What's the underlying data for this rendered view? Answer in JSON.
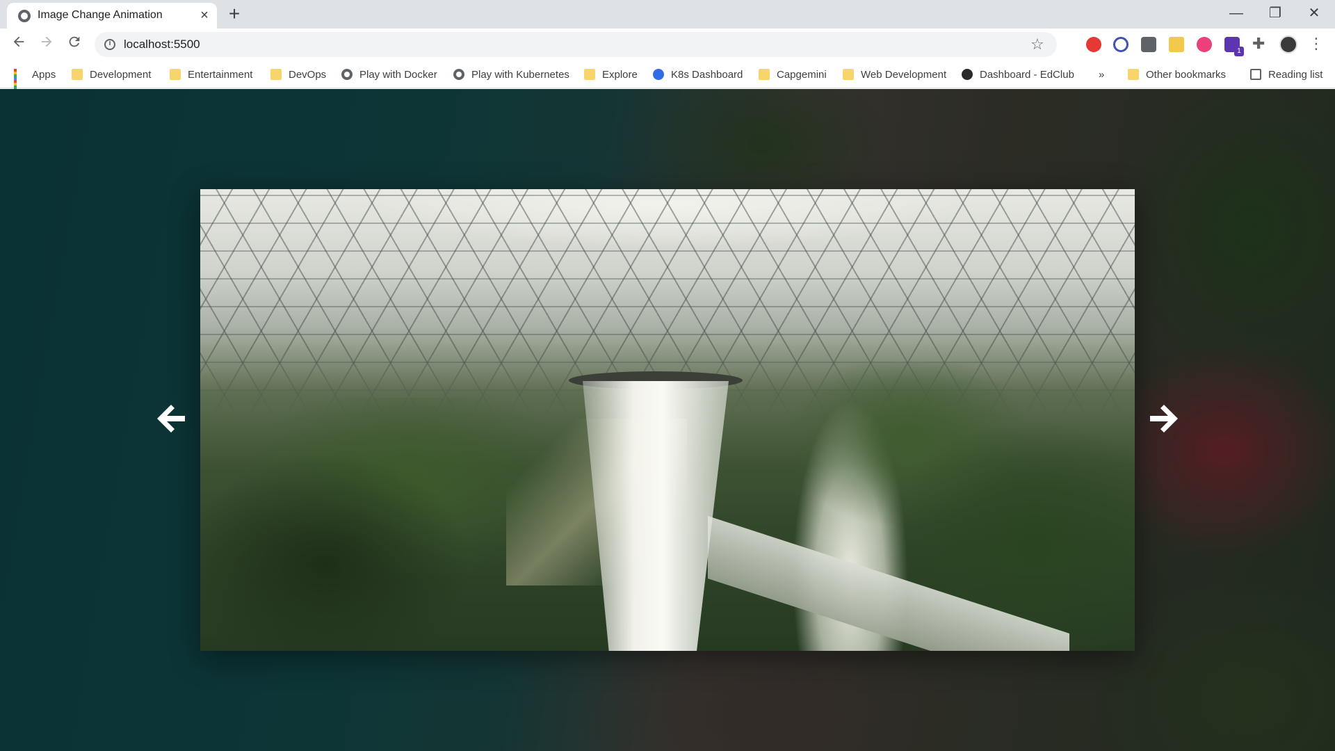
{
  "browser": {
    "tab_title": "Image Change Animation",
    "tab_close_glyph": "×",
    "new_tab_glyph": "+",
    "window_controls": [
      "—",
      "❐",
      "✕"
    ],
    "url": "localhost:5500"
  },
  "bookmarks": [
    {
      "label": "Apps",
      "icon": "apps-grid-icon"
    },
    {
      "label": "Development",
      "icon": "folder-icon"
    },
    {
      "label": "Entertainment",
      "icon": "folder-icon"
    },
    {
      "label": "DevOps",
      "icon": "folder-icon"
    },
    {
      "label": "Play with Docker",
      "icon": "globe-icon"
    },
    {
      "label": "Play with Kubernetes",
      "icon": "globe-icon"
    },
    {
      "label": "Explore",
      "icon": "folder-icon"
    },
    {
      "label": "K8s Dashboard",
      "icon": "kubernetes-icon"
    },
    {
      "label": "Capgemini",
      "icon": "folder-icon"
    },
    {
      "label": "Web Development",
      "icon": "folder-icon"
    },
    {
      "label": "Dashboard - EdClub",
      "icon": "edclub-icon"
    }
  ],
  "bookmarks_overflow": "»",
  "other_bookmarks": "Other bookmarks",
  "reading_list": "Reading list",
  "extensions": [
    {
      "name": "opera-extension-icon",
      "color": "#e53935"
    },
    {
      "name": "block-extension-icon",
      "color": "#3f51b5"
    },
    {
      "name": "grey-extension-icon",
      "color": "#5f6368"
    },
    {
      "name": "js-extension-icon",
      "color": "#f2c94c"
    },
    {
      "name": "pink-extension-icon",
      "color": "#ec407a"
    },
    {
      "name": "purple-extension-icon",
      "color": "#5e35b1"
    }
  ],
  "extension_badge": "1",
  "slider": {
    "prev_arrow": "arrow-left-icon",
    "next_arrow": "arrow-right-icon",
    "image_subject": "indoor waterfall under glass dome"
  },
  "colors": {
    "tabstrip": "#dee1e6",
    "page_left_teal": "#0f4448",
    "arrow": "#ffffff"
  }
}
